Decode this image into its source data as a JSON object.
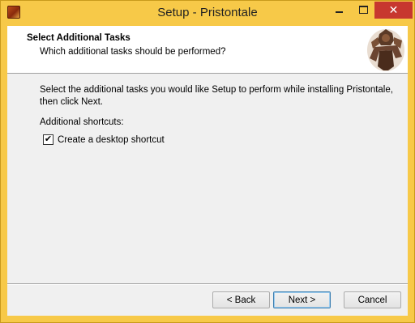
{
  "window": {
    "title": "Setup - Pristontale",
    "icon": "pristontale-app-icon"
  },
  "titlebar_controls": {
    "minimize": "minimize-icon",
    "maximize": "maximize-icon",
    "close": "close-icon",
    "close_glyph": "✕",
    "close_color": "#c7372f"
  },
  "header": {
    "title": "Select Additional Tasks",
    "subtitle": "Which additional tasks should be performed?",
    "image": "pristontale-character-logo"
  },
  "main": {
    "instructions": "Select the additional tasks you would like Setup to perform while installing Pristontale, then click Next.",
    "group_label": "Additional shortcuts:",
    "tasks": [
      {
        "label": "Create a desktop shortcut",
        "checked": true,
        "check_glyph": "✔"
      }
    ]
  },
  "buttons": {
    "back": "< Back",
    "next": "Next >",
    "cancel": "Cancel"
  },
  "colors": {
    "frame": "#f7c948",
    "client": "#f0f0f0",
    "header": "#ffffff"
  }
}
